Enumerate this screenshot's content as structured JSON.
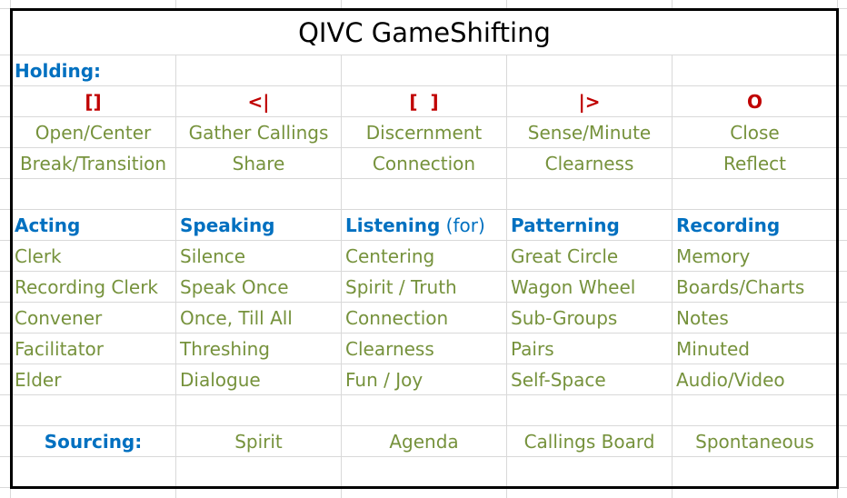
{
  "title": "QIVC GameShifting",
  "holding": {
    "label": "Holding:",
    "symbols": [
      "[]",
      "<|",
      "[  ]",
      "|>",
      "O"
    ],
    "row1": [
      "Open/Center",
      "Gather Callings",
      "Discernment",
      "Sense/Minute",
      "Close"
    ],
    "row2": [
      "Break/Transition",
      "Share",
      "Connection",
      "Clearness",
      "Reflect"
    ]
  },
  "categories": {
    "headers": [
      {
        "label": "Acting",
        "suffix": ""
      },
      {
        "label": "Speaking",
        "suffix": ""
      },
      {
        "label": "Listening",
        "suffix": " (for)"
      },
      {
        "label": "Patterning",
        "suffix": ""
      },
      {
        "label": "Recording",
        "suffix": ""
      }
    ],
    "rows": [
      [
        "Clerk",
        "Silence",
        "Centering",
        "Great Circle",
        "Memory"
      ],
      [
        "Recording Clerk",
        "Speak Once",
        "Spirit / Truth",
        "Wagon Wheel",
        "Boards/Charts"
      ],
      [
        "Convener",
        "Once, Till All",
        "Connection",
        "Sub-Groups",
        "Notes"
      ],
      [
        "Facilitator",
        "Threshing",
        "Clearness",
        "Pairs",
        "Minuted"
      ],
      [
        "Elder",
        "Dialogue",
        "Fun / Joy",
        "Self-Space",
        "Audio/Video"
      ]
    ]
  },
  "sourcing": {
    "label": "Sourcing:",
    "values": [
      "Spirit",
      "Agenda",
      "Callings Board",
      "Spontaneous"
    ]
  },
  "colors": {
    "heading_blue": "#0070c0",
    "text_green": "#76923c",
    "symbol_red": "#c00000"
  }
}
